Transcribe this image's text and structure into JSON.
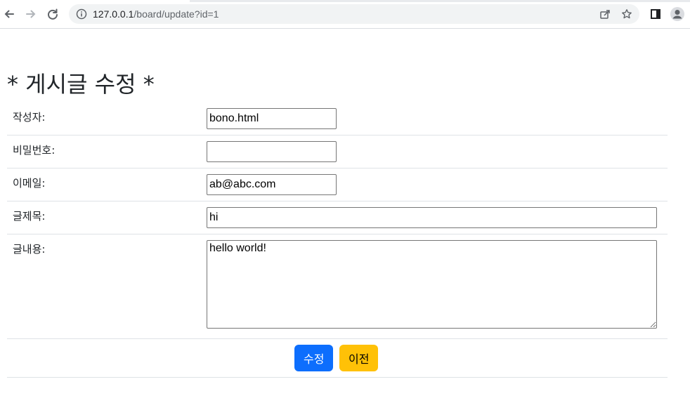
{
  "browser": {
    "url_host": "127.0.0.1",
    "url_path": "/board/update?id=1"
  },
  "page": {
    "title": "* 게시글 수정 *"
  },
  "form": {
    "writer": {
      "label": "작성자:",
      "value": "bono.html"
    },
    "password": {
      "label": "비밀번호:",
      "value": ""
    },
    "email": {
      "label": "이메일:",
      "value": "ab@abc.com"
    },
    "subject": {
      "label": "글제목:",
      "value": "hi"
    },
    "content": {
      "label": "글내용:",
      "value": "hello world!"
    }
  },
  "buttons": {
    "submit_label": "수정",
    "back_label": "이전"
  },
  "colors": {
    "primary": "#0d6efd",
    "warning": "#ffc107"
  }
}
